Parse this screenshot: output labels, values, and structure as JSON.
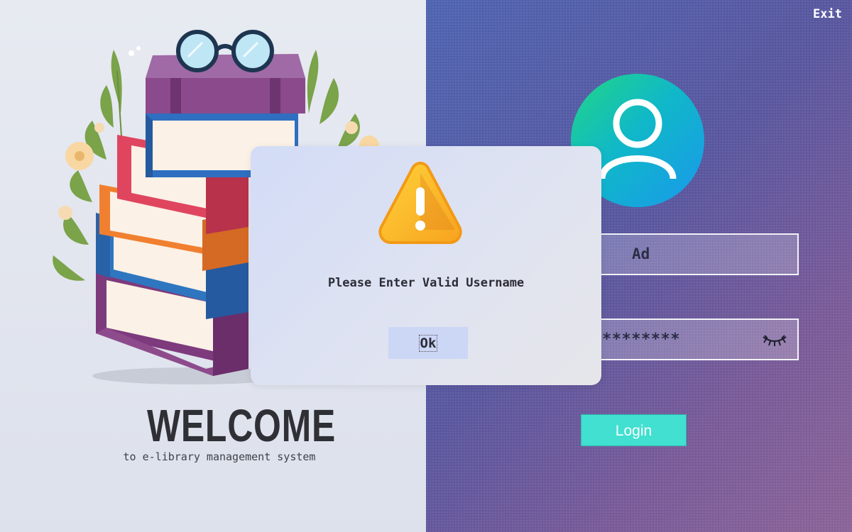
{
  "window": {
    "exit_label": "Exit"
  },
  "welcome": {
    "title": "WELCOME",
    "subtitle": "to e-library management system"
  },
  "login": {
    "username_value": "Ad",
    "password_value": "********",
    "login_label": "Login",
    "accent_color": "#41e0d0"
  },
  "dialog": {
    "message": "Please Enter Valid Username",
    "ok_label": "Ok",
    "icon": "warning-icon"
  },
  "icons": {
    "avatar": "user-icon",
    "password_toggle": "eye-closed-icon",
    "illustration": "books-stack-illustration"
  }
}
